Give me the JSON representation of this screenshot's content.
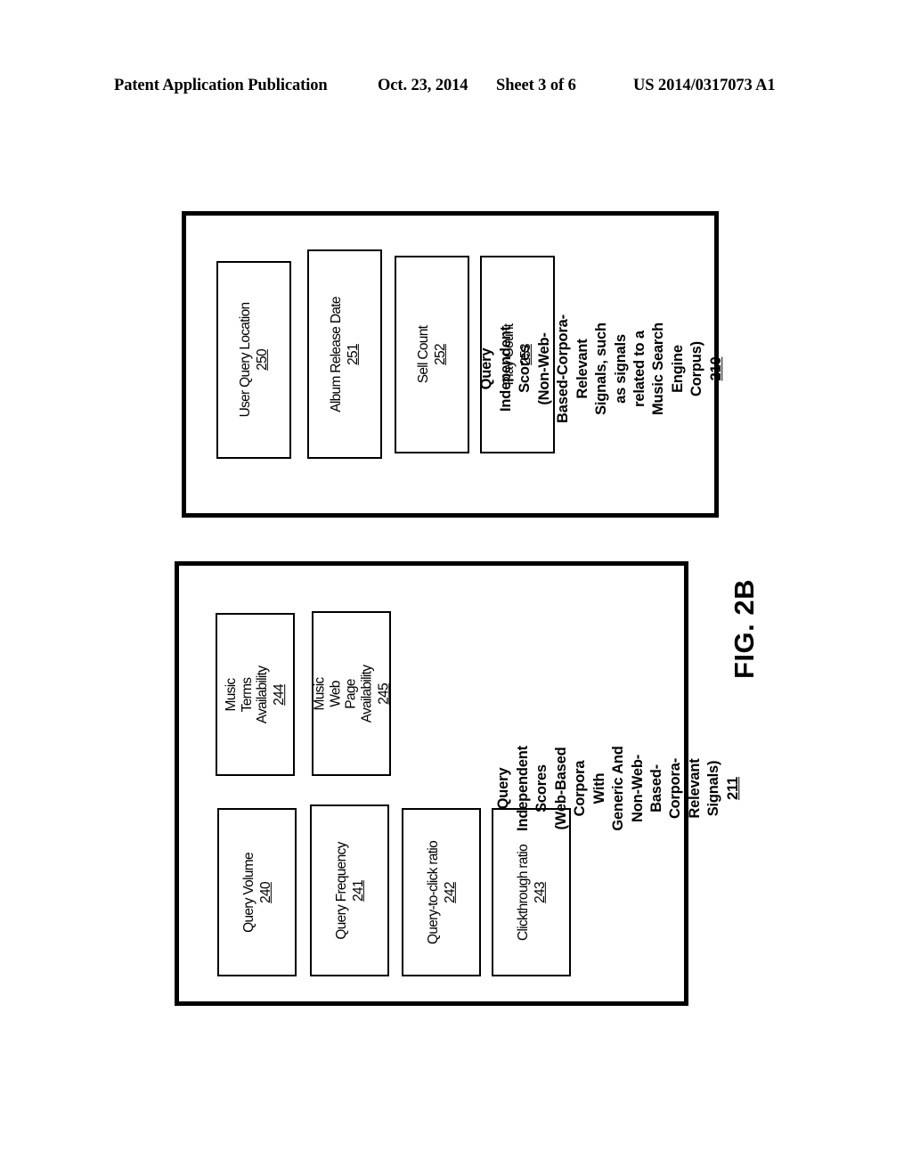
{
  "header": {
    "publication": "Patent Application Publication",
    "date": "Oct. 23, 2014",
    "sheet": "Sheet 3 of 6",
    "patent_number": "US 2014/0317073 A1"
  },
  "figure": {
    "label": "FIG. 2B"
  },
  "groups": [
    {
      "id": "210",
      "caption_text": "Query Independent Scores\n(Non-Web-Based-Corpora-\nRelevant Signals, such as signals\nrelated to a Music Search Engine\nCorpus)",
      "caption_ref": "210",
      "items": [
        {
          "label": "User Query Location",
          "ref": "250"
        },
        {
          "label": "Album Release Date",
          "ref": "251"
        },
        {
          "label": "Sell Count",
          "ref": "252"
        },
        {
          "label": "Play Count",
          "ref": "253"
        }
      ]
    },
    {
      "id": "211",
      "caption_text": "Query Independent Scores\n(Web-Based Corpora With Generic And Non-Web-\nBased-Corpora-Relevant Signals)",
      "caption_ref": "211",
      "items": [
        {
          "label": "Music Terms\nAvailability",
          "ref": "244"
        },
        {
          "label": "Music Web Page\nAvailability",
          "ref": "245"
        },
        {
          "label": "Query Volume",
          "ref": "240"
        },
        {
          "label": "Query Frequency",
          "ref": "241"
        },
        {
          "label": "Query-to-click ratio",
          "ref": "242"
        },
        {
          "label": "Clickthrough ratio",
          "ref": "243"
        }
      ]
    }
  ],
  "colors": {
    "ink": "#000000",
    "paper": "#ffffff"
  }
}
